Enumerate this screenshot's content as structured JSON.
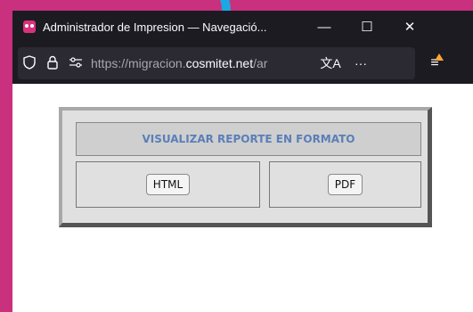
{
  "window": {
    "title": "Administrador de Impresion — Navegació...",
    "controls": {
      "minimize": "—",
      "maximize": "☐",
      "close": "✕"
    }
  },
  "toolbar": {
    "url_prefix": "https://migracion.",
    "url_host": "cosmitet.net",
    "url_suffix": "/ar",
    "translate_icon": "文A",
    "more_icon": "···",
    "menu_icon": "≡"
  },
  "page": {
    "heading": "VISUALIZAR REPORTE EN FORMATO",
    "buttons": {
      "html": "HTML",
      "pdf": "PDF"
    }
  },
  "colors": {
    "heading": "#5a7fb8",
    "accent_update": "#ffa436"
  }
}
